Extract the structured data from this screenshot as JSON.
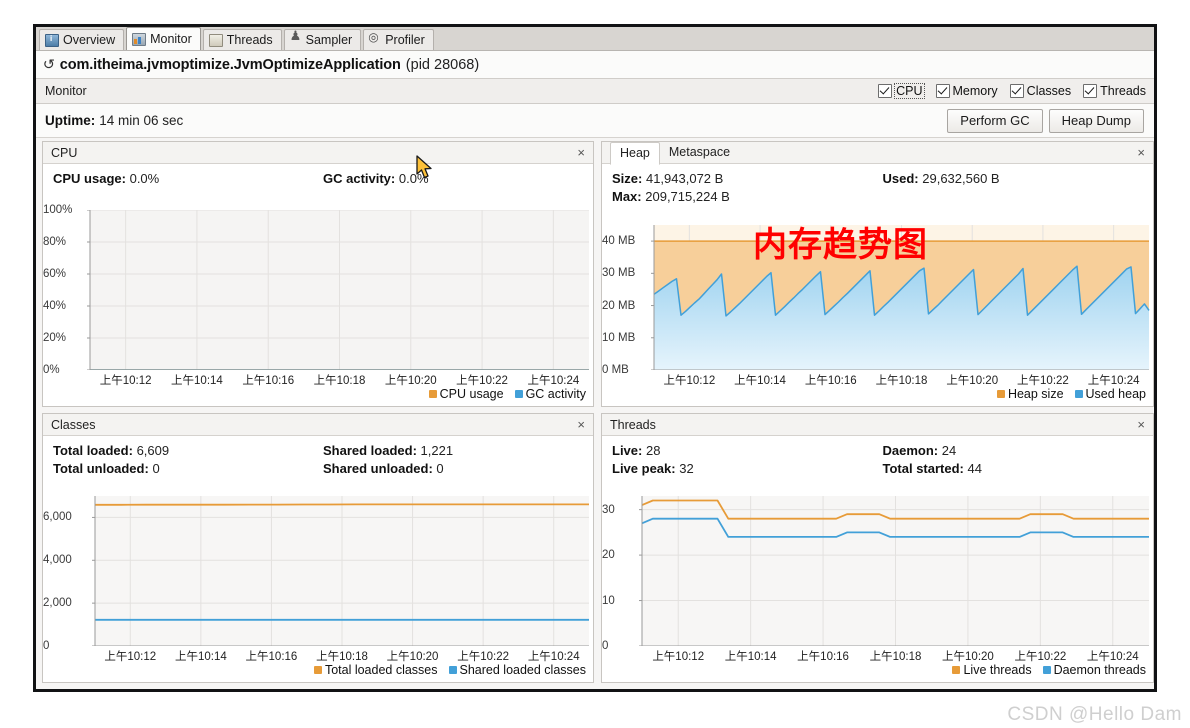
{
  "tabs": [
    {
      "label": "Overview",
      "icon": "overview-icon",
      "active": false
    },
    {
      "label": "Monitor",
      "icon": "monitor-icon",
      "active": true
    },
    {
      "label": "Threads",
      "icon": "threads-icon",
      "active": false
    },
    {
      "label": "Sampler",
      "icon": "sampler-icon",
      "active": false
    },
    {
      "label": "Profiler",
      "icon": "profiler-icon",
      "active": false
    }
  ],
  "app": {
    "name": "com.itheima.jvmoptimize.JvmOptimizeApplication",
    "pid": "(pid 28068)",
    "refresh_icon": "refresh-icon"
  },
  "monitor_bar": {
    "title": "Monitor",
    "checkboxes": [
      {
        "label": "CPU",
        "checked": true,
        "focused": true
      },
      {
        "label": "Memory",
        "checked": true,
        "focused": false
      },
      {
        "label": "Classes",
        "checked": true,
        "focused": false
      },
      {
        "label": "Threads",
        "checked": true,
        "focused": false
      }
    ]
  },
  "uptime": {
    "key": "Uptime:",
    "value": "14 min 06 sec",
    "perform_gc": "Perform GC",
    "heap_dump": "Heap Dump"
  },
  "cpu_panel": {
    "title": "CPU",
    "close": "×",
    "stats": [
      {
        "key": "CPU usage:",
        "value": "0.0%"
      },
      {
        "key": "GC activity:",
        "value": "0.0%"
      }
    ]
  },
  "heap_panel": {
    "tabs": [
      {
        "label": "Heap",
        "active": true
      },
      {
        "label": "Metaspace",
        "active": false
      }
    ],
    "close": "×",
    "stats_left": [
      {
        "key": "Size:",
        "value": "41,943,072 B"
      },
      {
        "key": "Max:",
        "value": "209,715,224 B"
      }
    ],
    "stats_right": [
      {
        "key": "Used:",
        "value": "29,632,560 B"
      }
    ]
  },
  "classes_panel": {
    "title": "Classes",
    "close": "×",
    "stats_left": [
      {
        "key": "Total loaded:",
        "value": "6,609"
      },
      {
        "key": "Total unloaded:",
        "value": "0"
      }
    ],
    "stats_right": [
      {
        "key": "Shared loaded:",
        "value": "1,221"
      },
      {
        "key": "Shared unloaded:",
        "value": "0"
      }
    ]
  },
  "threads_panel": {
    "title": "Threads",
    "close": "×",
    "stats_left": [
      {
        "key": "Live:",
        "value": "28"
      },
      {
        "key": "Live peak:",
        "value": "32"
      }
    ],
    "stats_right": [
      {
        "key": "Daemon:",
        "value": "24"
      },
      {
        "key": "Total started:",
        "value": "44"
      }
    ]
  },
  "annotation": {
    "text": "内存趋势图",
    "color": "#ff0000"
  },
  "watermark": "CSDN @Hello Dam",
  "colors": {
    "orange": "#e79b38",
    "orange_fill": "#f7cf9a",
    "blue": "#42a0d8",
    "blue_fill": "#bfe2f5",
    "grid": "#e3e1df",
    "axis": "#9a9a9a"
  },
  "chart_data": [
    {
      "type": "line",
      "name": "cpu-chart",
      "title": "CPU",
      "xlabel": "",
      "ylabel": "",
      "ylim": [
        0,
        100
      ],
      "yticks": [
        "0%",
        "20%",
        "40%",
        "60%",
        "80%",
        "100%"
      ],
      "ytick_values": [
        0,
        20,
        40,
        60,
        80,
        100
      ],
      "xticks": [
        "上午10:12",
        "上午10:14",
        "上午10:16",
        "上午10:18",
        "上午10:20",
        "上午10:22",
        "上午10:24"
      ],
      "legend": [
        {
          "label": "CPU usage",
          "color": "#e79b38"
        },
        {
          "label": "GC activity",
          "color": "#42a0d8"
        }
      ],
      "series": [
        {
          "name": "CPU usage",
          "color": "#e79b38",
          "values": [
            0,
            0,
            0,
            0,
            0,
            0,
            0,
            0,
            0,
            0,
            0,
            0,
            0,
            0,
            0,
            0,
            0,
            0,
            0,
            0,
            0,
            0,
            0,
            0,
            0
          ]
        },
        {
          "name": "GC activity",
          "color": "#42a0d8",
          "values": [
            0,
            0,
            0,
            0,
            0,
            0,
            0,
            0,
            0,
            0,
            0,
            0,
            0,
            0,
            0,
            0,
            0,
            0,
            0,
            0,
            0,
            0,
            0,
            0,
            0
          ]
        }
      ]
    },
    {
      "type": "area",
      "name": "heap-chart",
      "title": "Heap",
      "xlabel": "",
      "ylabel": "",
      "ylim": [
        0,
        45
      ],
      "yticks": [
        "0 MB",
        "10 MB",
        "20 MB",
        "30 MB",
        "40 MB"
      ],
      "ytick_values": [
        0,
        10,
        20,
        30,
        40
      ],
      "xticks": [
        "上午10:12",
        "上午10:14",
        "上午10:16",
        "上午10:18",
        "上午10:20",
        "上午10:22",
        "上午10:24"
      ],
      "legend": [
        {
          "label": "Heap size",
          "color": "#e79b38"
        },
        {
          "label": "Used heap",
          "color": "#42a0d8"
        }
      ],
      "series": [
        {
          "name": "Heap size",
          "color": "#e79b38",
          "values": [
            40,
            40,
            40,
            40,
            40,
            40,
            40,
            40,
            40,
            40,
            40,
            40,
            40,
            40,
            40,
            40,
            40,
            40,
            40,
            40,
            40,
            40,
            40,
            40,
            40,
            40,
            40,
            40,
            40,
            40,
            40,
            40,
            40,
            40,
            40,
            40,
            40,
            40,
            40,
            40,
            40,
            40,
            40,
            40,
            40,
            40,
            40,
            40,
            40,
            40,
            40,
            40,
            40,
            40,
            40,
            40,
            40,
            40,
            40,
            40,
            40,
            40,
            40,
            40,
            40,
            40,
            40,
            40,
            40,
            40,
            40,
            40,
            40,
            40,
            40,
            40,
            40,
            40,
            40,
            40,
            40,
            40,
            40,
            40,
            40,
            40,
            40,
            40,
            40,
            40,
            40,
            40,
            40,
            40,
            40,
            40,
            40,
            40,
            40,
            40
          ]
        },
        {
          "name": "Used heap",
          "color": "#42a0d8",
          "comment": "sawtooth: 10 GC cycles rising ~17 to ~31 MB then dropping",
          "values": [
            23.5,
            24.5,
            25.5,
            26.5,
            27.5,
            28.3,
            17.0,
            18.2,
            19.5,
            20.8,
            22.0,
            23.5,
            25.0,
            26.5,
            28.0,
            29.8,
            16.8,
            18.0,
            19.3,
            20.6,
            22.0,
            23.4,
            24.8,
            26.2,
            27.6,
            29.0,
            30.2,
            17.0,
            18.3,
            19.6,
            21.0,
            22.3,
            23.7,
            25.0,
            26.4,
            27.8,
            29.2,
            30.5,
            17.2,
            18.5,
            19.8,
            21.1,
            22.5,
            23.8,
            25.2,
            26.6,
            28.0,
            29.4,
            30.8,
            17.0,
            18.3,
            19.7,
            21.0,
            22.4,
            23.8,
            25.2,
            26.6,
            28.0,
            29.4,
            30.8,
            31.6,
            17.4,
            18.7,
            20.0,
            21.4,
            22.8,
            24.2,
            25.6,
            27.0,
            28.4,
            29.8,
            31.2,
            17.2,
            18.6,
            20.0,
            21.4,
            22.8,
            24.2,
            25.6,
            27.0,
            28.4,
            29.8,
            31.5,
            17.0,
            18.4,
            19.8,
            21.2,
            22.6,
            24.0,
            25.4,
            26.8,
            28.2,
            29.6,
            31.0,
            32.2,
            17.3,
            18.7,
            20.1,
            21.5,
            22.9,
            24.3,
            25.7,
            27.1,
            28.5,
            29.9,
            31.3,
            32.0,
            17.5,
            19.0,
            20.5,
            18.5
          ]
        }
      ]
    },
    {
      "type": "line",
      "name": "classes-chart",
      "title": "Classes",
      "xlabel": "",
      "ylabel": "",
      "ylim": [
        0,
        7000
      ],
      "yticks": [
        "0",
        "2,000",
        "4,000",
        "6,000"
      ],
      "ytick_values": [
        0,
        2000,
        4000,
        6000
      ],
      "xticks": [
        "上午10:12",
        "上午10:14",
        "上午10:16",
        "上午10:18",
        "上午10:20",
        "上午10:22",
        "上午10:24"
      ],
      "legend": [
        {
          "label": "Total loaded classes",
          "color": "#e79b38"
        },
        {
          "label": "Shared loaded classes",
          "color": "#42a0d8"
        }
      ],
      "series": [
        {
          "name": "Total loaded classes",
          "color": "#e79b38",
          "values": [
            6590,
            6590,
            6592,
            6592,
            6595,
            6595,
            6600,
            6600,
            6605,
            6605,
            6607,
            6607,
            6609,
            6609,
            6609,
            6609,
            6609,
            6609,
            6609,
            6609
          ]
        },
        {
          "name": "Shared loaded classes",
          "color": "#42a0d8",
          "values": [
            1221,
            1221,
            1221,
            1221,
            1221,
            1221,
            1221,
            1221,
            1221,
            1221,
            1221,
            1221,
            1221,
            1221,
            1221,
            1221,
            1221,
            1221,
            1221,
            1221
          ]
        }
      ]
    },
    {
      "type": "line",
      "name": "threads-chart",
      "title": "Threads",
      "xlabel": "",
      "ylabel": "",
      "ylim": [
        0,
        33
      ],
      "yticks": [
        "0",
        "10",
        "20",
        "30"
      ],
      "ytick_values": [
        0,
        10,
        20,
        30
      ],
      "xticks": [
        "上午10:12",
        "上午10:14",
        "上午10:16",
        "上午10:18",
        "上午10:20",
        "上午10:22",
        "上午10:24"
      ],
      "legend": [
        {
          "label": "Live threads",
          "color": "#e79b38"
        },
        {
          "label": "Daemon threads",
          "color": "#42a0d8"
        }
      ],
      "series": [
        {
          "name": "Live threads",
          "color": "#e79b38",
          "values": [
            31,
            32,
            32,
            32,
            32,
            32,
            32,
            32,
            28,
            28,
            28,
            28,
            28,
            28,
            28,
            28,
            28,
            28,
            28,
            29,
            29,
            29,
            29,
            28,
            28,
            28,
            28,
            28,
            28,
            28,
            28,
            28,
            28,
            28,
            28,
            28,
            29,
            29,
            29,
            29,
            28,
            28,
            28,
            28,
            28,
            28,
            28,
            28
          ]
        },
        {
          "name": "Daemon threads",
          "color": "#42a0d8",
          "values": [
            27,
            28,
            28,
            28,
            28,
            28,
            28,
            28,
            24,
            24,
            24,
            24,
            24,
            24,
            24,
            24,
            24,
            24,
            24,
            25,
            25,
            25,
            25,
            24,
            24,
            24,
            24,
            24,
            24,
            24,
            24,
            24,
            24,
            24,
            24,
            24,
            25,
            25,
            25,
            25,
            24,
            24,
            24,
            24,
            24,
            24,
            24,
            24
          ]
        }
      ]
    }
  ]
}
